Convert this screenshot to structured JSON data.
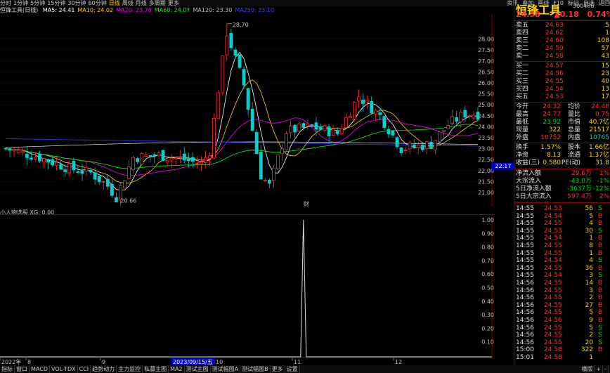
{
  "topbar": {
    "tabs": [
      "分时",
      "1分钟",
      "5分钟",
      "15分钟",
      "30分钟",
      "60分钟",
      "日线",
      "周线",
      "月线",
      "多周期",
      "更多"
    ],
    "active_tab": "日线",
    "right_items": [
      "资讯",
      "叠加",
      "画线",
      "F10",
      "标记",
      "自选",
      "返回"
    ]
  },
  "ma_line": {
    "name": "恒锋工具(日线)",
    "items": [
      {
        "label": "MA5: 24.41",
        "color": "#ffffff"
      },
      {
        "label": "MA10: 24.02",
        "color": "#ffd700"
      },
      {
        "label": "MA20: 23.78",
        "color": "#ff00ff"
      },
      {
        "label": "MA60: 24.07",
        "color": "#00ff00"
      },
      {
        "label": "MA120: 23.30",
        "color": "#c0c0c0"
      },
      {
        "label": "MA250: 23.10",
        "color": "#4040ff"
      }
    ]
  },
  "colors": {
    "up": "#ff3030",
    "down": "#00d0d0",
    "accent": "#ffd700"
  },
  "price_axis": {
    "labels": [
      "28.00",
      "27.50",
      "27.00",
      "26.50",
      "26.00",
      "25.50",
      "25.00",
      "24.50",
      "24.00",
      "23.50",
      "23.00",
      "22.50",
      "22.00",
      "21.50",
      "21.00"
    ],
    "current": "22.17"
  },
  "price_annotations": {
    "high": "28.70",
    "low": "20.66",
    "marker": "财"
  },
  "indicator": {
    "title": "小人物选股 XG: 0.00",
    "labels": [
      "1.00",
      "0.90",
      "0.80",
      "0.70",
      "0.60",
      "0.50",
      "0.40",
      "0.30",
      "0.20",
      "0.10"
    ]
  },
  "x_axis": {
    "labels": [
      "2022年",
      "8",
      "9",
      "10",
      "11",
      "12"
    ],
    "highlight": "2023/09/15/五"
  },
  "bottombar": {
    "tabs": [
      "指标",
      "窗口",
      "MACD",
      "VOL-TDX",
      "CCI",
      "趋势动力",
      "主力监控",
      "私募主图",
      "MA2",
      "测试主图",
      "测试幅图A",
      "测试幅图B",
      "更多",
      "设置"
    ],
    "right_items": [
      "横版",
      "+",
      "-"
    ]
  },
  "quote": {
    "stock_name": "恒锋工具",
    "stock_code": "300488",
    "price": "24.58",
    "change": "▲0.18",
    "change_pct": "0.74%",
    "asks": [
      {
        "label": "卖五",
        "price": "24.63",
        "vol": "5"
      },
      {
        "label": "卖四",
        "price": "24.62",
        "vol": "1"
      },
      {
        "label": "卖三",
        "price": "24.60",
        "vol": "108"
      },
      {
        "label": "卖二",
        "price": "24.59",
        "vol": "57"
      },
      {
        "label": "卖一",
        "price": "24.58",
        "vol": "43"
      }
    ],
    "bids": [
      {
        "label": "买一",
        "price": "24.57",
        "vol": "15"
      },
      {
        "label": "买二",
        "price": "24.56",
        "vol": "23"
      },
      {
        "label": "买三",
        "price": "24.55",
        "vol": "40"
      },
      {
        "label": "买四",
        "price": "24.54",
        "vol": "13"
      },
      {
        "label": "买五",
        "price": "24.53",
        "vol": "17"
      }
    ],
    "stats": [
      {
        "l1": "今开",
        "v1": "24.32",
        "l2": "均价",
        "v2": "24.48"
      },
      {
        "l1": "最高",
        "v1": "24.77",
        "l2": "量比",
        "v2": "0.75"
      },
      {
        "l1": "最低",
        "v1": "23.92",
        "l2": "市值",
        "v2": "40.7亿"
      },
      {
        "l1": "现量",
        "v1": "322",
        "l2": "总量",
        "v2": "21517"
      },
      {
        "l1": "外盘",
        "v1": "10752",
        "l2": "内盘",
        "v2": "10765"
      },
      {
        "l1": "换手",
        "v1": "1.57%",
        "l2": "股本",
        "v2": "1.66亿"
      },
      {
        "l1": "净资",
        "v1": "8.13",
        "l2": "流通",
        "v2": "1.37亿"
      },
      {
        "l1": "收益(三)",
        "v1": "0.580",
        "l2": "PE(动)",
        "v2": "31.8"
      }
    ],
    "flows": [
      {
        "label": "净流入额",
        "value": "29.6万",
        "pct": "1%"
      },
      {
        "label": "大宗流入",
        "value": "-43.0万",
        "pct": "-1%"
      },
      {
        "label": "5日净流入额",
        "value": "-3637万",
        "pct": "-12%"
      },
      {
        "label": "5日大宗流入",
        "value": "597.4万",
        "pct": "2%"
      }
    ],
    "ticks": [
      {
        "t": "14:55",
        "p": "24.53",
        "v": "56",
        "d": "S"
      },
      {
        "t": "14:55",
        "p": "24.54",
        "v": "5",
        "d": "B"
      },
      {
        "t": "14:55",
        "p": "24.55",
        "v": "4",
        "d": "B"
      },
      {
        "t": "14:55",
        "p": "24.53",
        "v": "30",
        "d": "S"
      },
      {
        "t": "14:55",
        "p": "24.54",
        "v": "1",
        "d": "B"
      },
      {
        "t": "14:55",
        "p": "24.55",
        "v": "8",
        "d": "B"
      },
      {
        "t": "14:55",
        "p": "24.55",
        "v": "1",
        "d": "B"
      },
      {
        "t": "14:55",
        "p": "24.54",
        "v": "4",
        "d": "S"
      },
      {
        "t": "14:55",
        "p": "24.55",
        "v": "36",
        "d": "B"
      },
      {
        "t": "14:55",
        "p": "24.54",
        "v": "3",
        "d": "S"
      },
      {
        "t": "14:56",
        "p": "24.55",
        "v": "14",
        "d": "B"
      },
      {
        "t": "14:56",
        "p": "24.55",
        "v": "3",
        "d": "B"
      },
      {
        "t": "14:56",
        "p": "24.55",
        "v": "2",
        "d": "B"
      },
      {
        "t": "14:56",
        "p": "24.55",
        "v": "27",
        "d": "B"
      },
      {
        "t": "14:56",
        "p": "24.55",
        "v": "5",
        "d": "B"
      },
      {
        "t": "14:56",
        "p": "24.56",
        "v": "9",
        "d": "B"
      },
      {
        "t": "14:56",
        "p": "24.55",
        "v": "5",
        "d": "S"
      },
      {
        "t": "14:56",
        "p": "24.55",
        "v": "2",
        "d": "S"
      },
      {
        "t": "14:56",
        "p": "24.55",
        "v": "20",
        "d": "S"
      },
      {
        "t": "15:00",
        "p": "24.58",
        "v": "322",
        "d": "B"
      },
      {
        "t": "15:01",
        "p": "24.58",
        "v": "1",
        "d": ""
      }
    ]
  }
}
